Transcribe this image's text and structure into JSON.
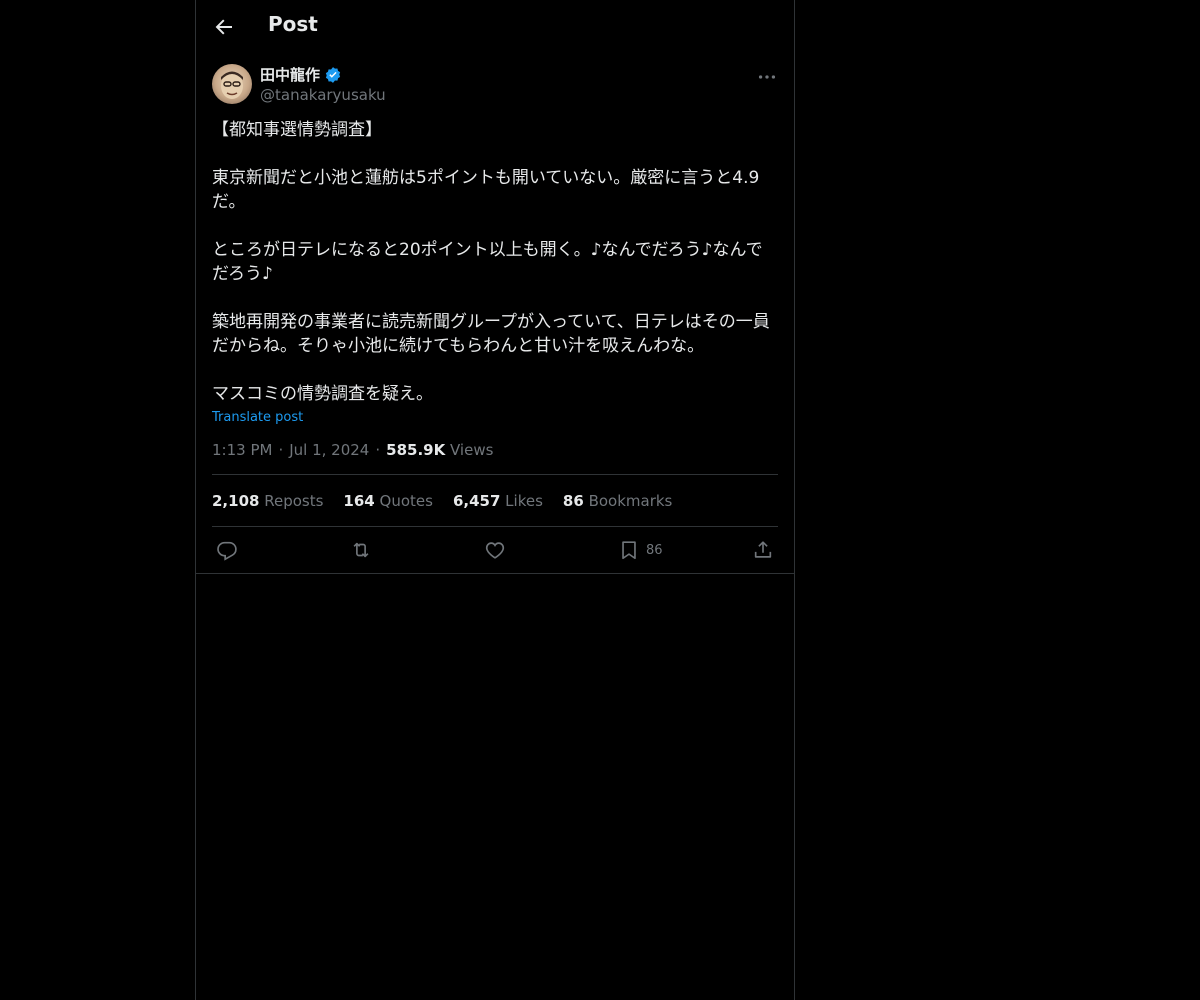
{
  "header": {
    "title": "Post"
  },
  "author": {
    "display_name": "田中龍作",
    "handle": "@tanakaryusaku",
    "verified": true
  },
  "post": {
    "text": "【都知事選情勢調査】\n\n東京新聞だと小池と蓮舫は5ポイントも開いていない。厳密に言うと4.9だ。\n\nところが日テレになると20ポイント以上も開く。♪なんでだろう♪なんでだろう♪\n\n築地再開発の事業者に読売新聞グループが入っていて、日テレはその一員だからね。そりゃ小池に続けてもらわんと甘い汁を吸えんわな。\n\nマスコミの情勢調査を疑え。",
    "translate_label": "Translate post",
    "time": "1:13 PM",
    "date": "Jul 1, 2024",
    "views_count": "585.9K",
    "views_label": "Views"
  },
  "stats": [
    {
      "count": "2,108",
      "label": "Reposts"
    },
    {
      "count": "164",
      "label": "Quotes"
    },
    {
      "count": "6,457",
      "label": "Likes"
    },
    {
      "count": "86",
      "label": "Bookmarks"
    }
  ],
  "actions": {
    "bookmark_count": "86"
  },
  "colors": {
    "background": "#000000",
    "text": "#e7e9ea",
    "secondary": "#71767b",
    "accent": "#1d9bf0",
    "border": "#2f3336"
  },
  "icons": [
    "back-arrow-icon",
    "verified-badge-icon",
    "more-icon",
    "reply-icon",
    "repost-icon",
    "like-icon",
    "bookmark-icon",
    "share-icon"
  ]
}
